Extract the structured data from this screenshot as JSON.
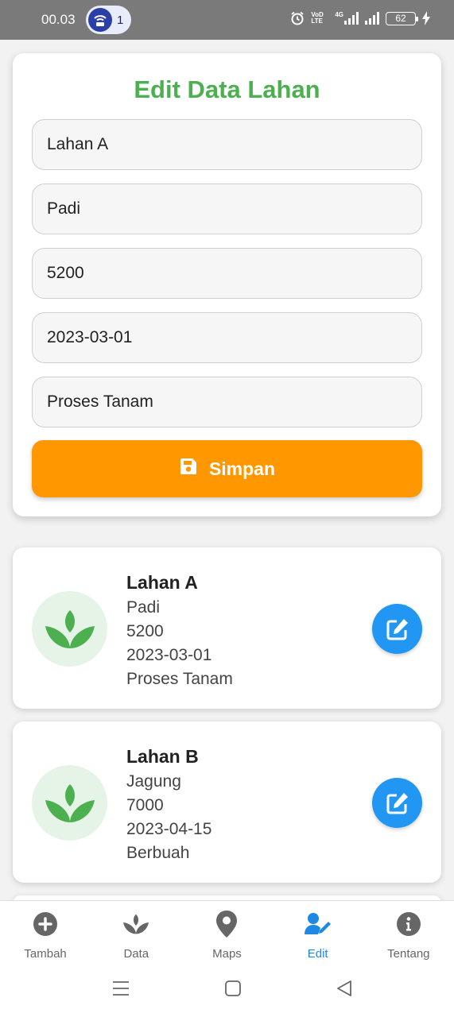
{
  "status_bar": {
    "time": "00.03",
    "hotspot_count": "1",
    "network_tag_1": "VoD LTE",
    "network_tag_2": "4G",
    "battery": "62"
  },
  "form": {
    "title": "Edit Data Lahan",
    "fields": {
      "name": "Lahan A",
      "crop": "Padi",
      "area": "5200",
      "date": "2023-03-01",
      "status": "Proses Tanam"
    },
    "save_label": "Simpan",
    "save_color": "#ff9800"
  },
  "list": [
    {
      "name": "Lahan A",
      "crop": "Padi",
      "area": "5200",
      "date": "2023-03-01",
      "status": "Proses Tanam"
    },
    {
      "name": "Lahan B",
      "crop": "Jagung",
      "area": "7000",
      "date": "2023-04-15",
      "status": "Berbuah"
    }
  ],
  "nav": {
    "items": [
      {
        "label": "Tambah",
        "icon": "plus-circle-icon"
      },
      {
        "label": "Data",
        "icon": "seedling-icon"
      },
      {
        "label": "Maps",
        "icon": "map-pin-icon"
      },
      {
        "label": "Edit",
        "icon": "user-edit-icon"
      },
      {
        "label": "Tentang",
        "icon": "info-circle-icon"
      }
    ],
    "active_index": 3,
    "active_color": "#1e88e5"
  },
  "colors": {
    "title_green": "#4caf50",
    "edit_fab_blue": "#2196f3"
  }
}
